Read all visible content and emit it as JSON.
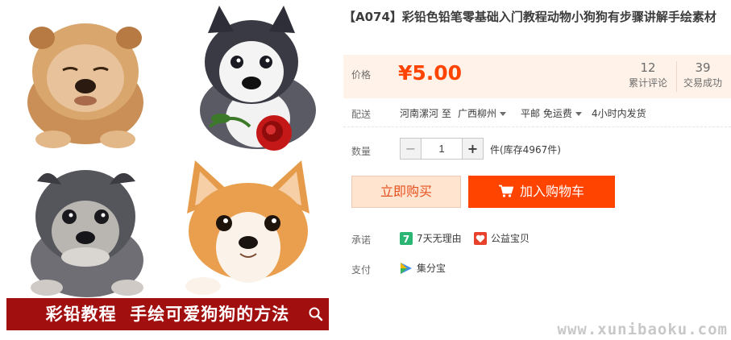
{
  "product": {
    "title": "【A074】彩铅色铅笔零基础入门教程动物小狗狗有步骤讲解手绘素材"
  },
  "gallery": {
    "banner_text": "彩铅教程  手绘可爱狗狗的方法",
    "icons": [
      "chow-puppy-drawing",
      "husky-puppy-with-rose-drawing",
      "schnauzer-puppy-drawing",
      "corgi-puppy-drawing",
      "zoom-icon"
    ]
  },
  "price": {
    "label": "价格",
    "value": "¥5.00"
  },
  "stats": {
    "reviews": {
      "count": "12",
      "label": "累计评论"
    },
    "deals": {
      "count": "39",
      "label": "交易成功"
    }
  },
  "shipping": {
    "label": "配送",
    "from": "河南漯河 至",
    "to": "广西柳州",
    "fee": "平邮 免运费",
    "dispatch": "4小时内发货"
  },
  "quantity": {
    "label": "数量",
    "minus": "−",
    "plus": "+",
    "value": "1",
    "stock": "件(库存4967件)"
  },
  "buttons": {
    "buy_now": "立即购买",
    "add_to_cart": "加入购物车"
  },
  "promise": {
    "label": "承诺",
    "items": [
      {
        "icon": "seven-day-return-icon",
        "text": "7天无理由",
        "color": "#2bb673"
      },
      {
        "icon": "charity-heart-icon",
        "text": "公益宝贝",
        "color": "#e8412c"
      }
    ]
  },
  "payment": {
    "label": "支付",
    "method": "集分宝",
    "icon": "jifenbao-icon"
  },
  "watermark": "www.xunibaoku.com",
  "colors": {
    "accent": "#ff4400",
    "price_bg": "#fff2e8",
    "banner": "#a10f0f"
  }
}
